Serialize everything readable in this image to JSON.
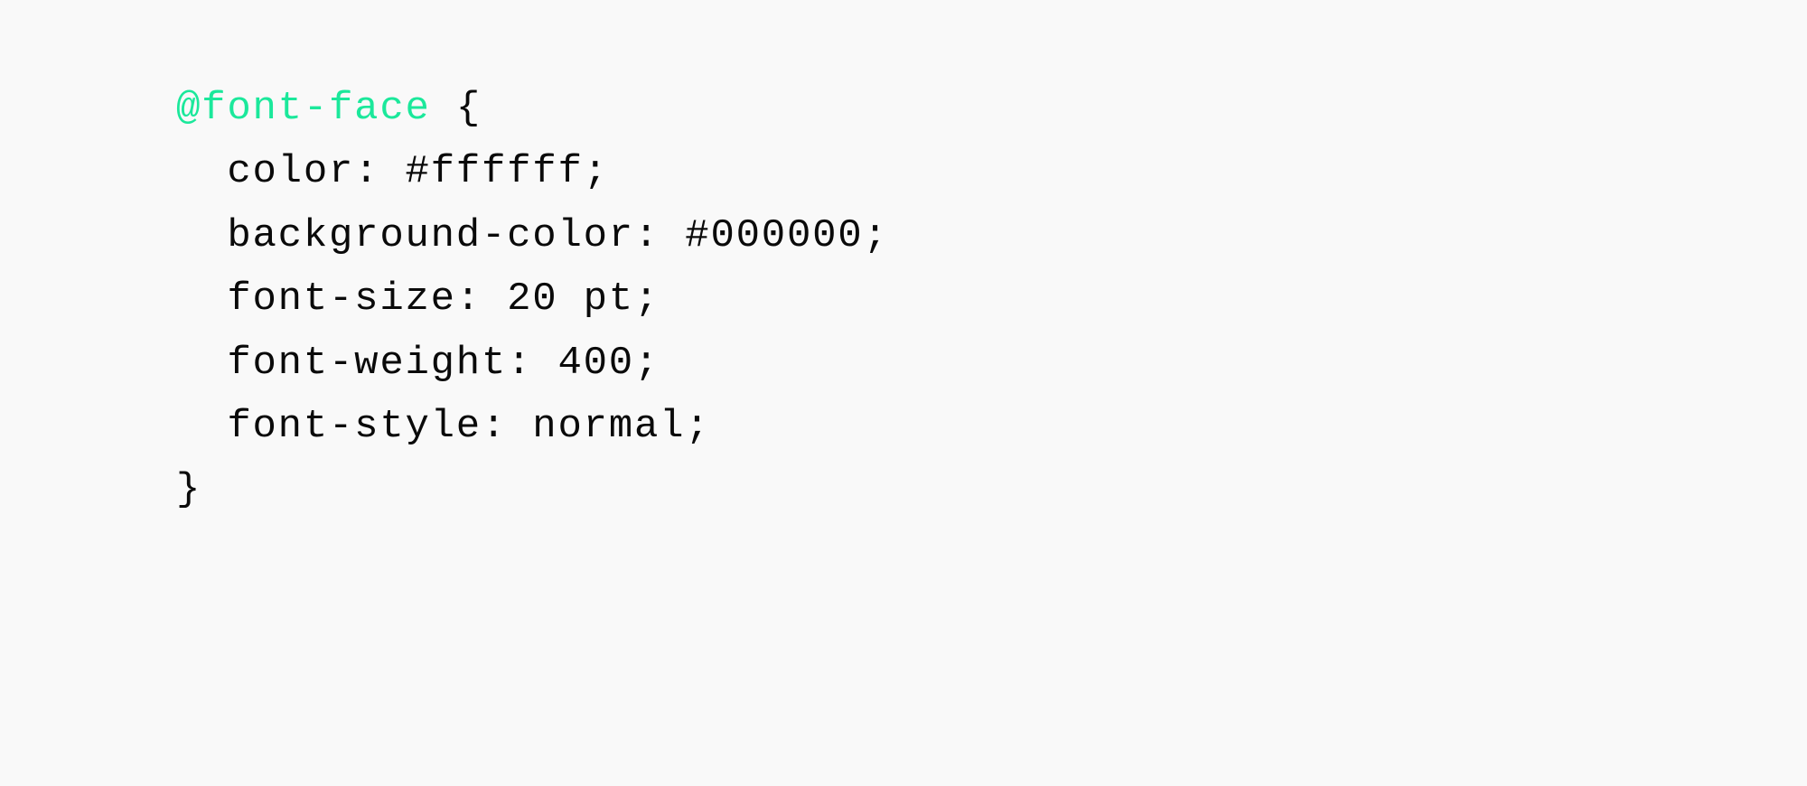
{
  "code": {
    "atRule": "@font-face",
    "openBrace": " {",
    "lines": [
      "  color: #ffffff;",
      "  background-color: #000000;",
      "  font-size: 20 pt;",
      "  font-weight: 400;",
      "  font-style: normal;"
    ],
    "closeBrace": "}"
  },
  "colors": {
    "background": "#f9f9f9",
    "text": "#0a0a0a",
    "highlight": "#1be89b"
  }
}
